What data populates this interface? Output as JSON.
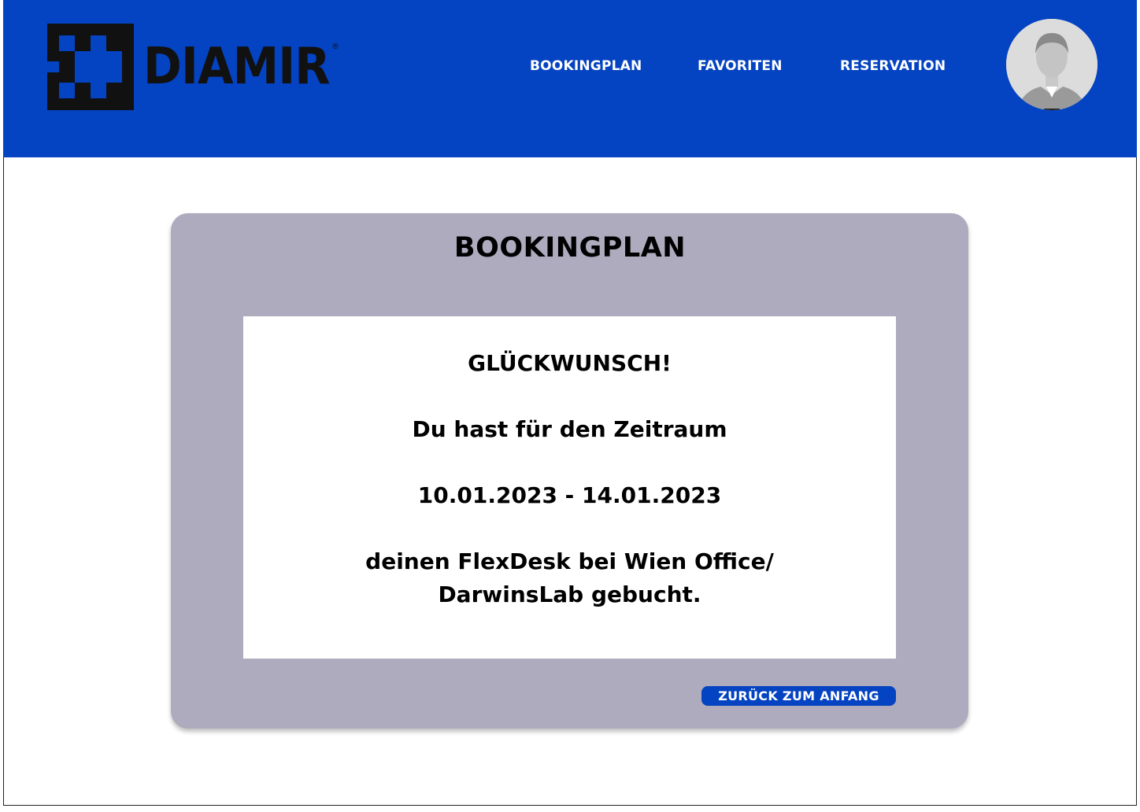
{
  "brand": {
    "name": "DIAMIR",
    "registered_mark": "®"
  },
  "nav": {
    "items": [
      {
        "label": "BOOKINGPLAN"
      },
      {
        "label": "FAVORITEN"
      },
      {
        "label": "RESERVATION"
      }
    ]
  },
  "user": {
    "avatar_icon": "user-avatar-photo"
  },
  "card": {
    "title": "BOOKINGPLAN",
    "message": {
      "headline": "GLÜCKWUNSCH!",
      "line1": "Du hast für den Zeitraum",
      "date_range": "10.01.2023 - 14.01.2023",
      "line3a": "deinen FlexDesk bei Wien Office/",
      "line3b": "DarwinsLab gebucht."
    },
    "back_button": "ZURÜCK ZUM ANFANG"
  },
  "colors": {
    "header_blue": "#0443c1",
    "card_gray": "#adabbd",
    "panel_white": "#ffffff",
    "logo_dark": "#111111"
  }
}
